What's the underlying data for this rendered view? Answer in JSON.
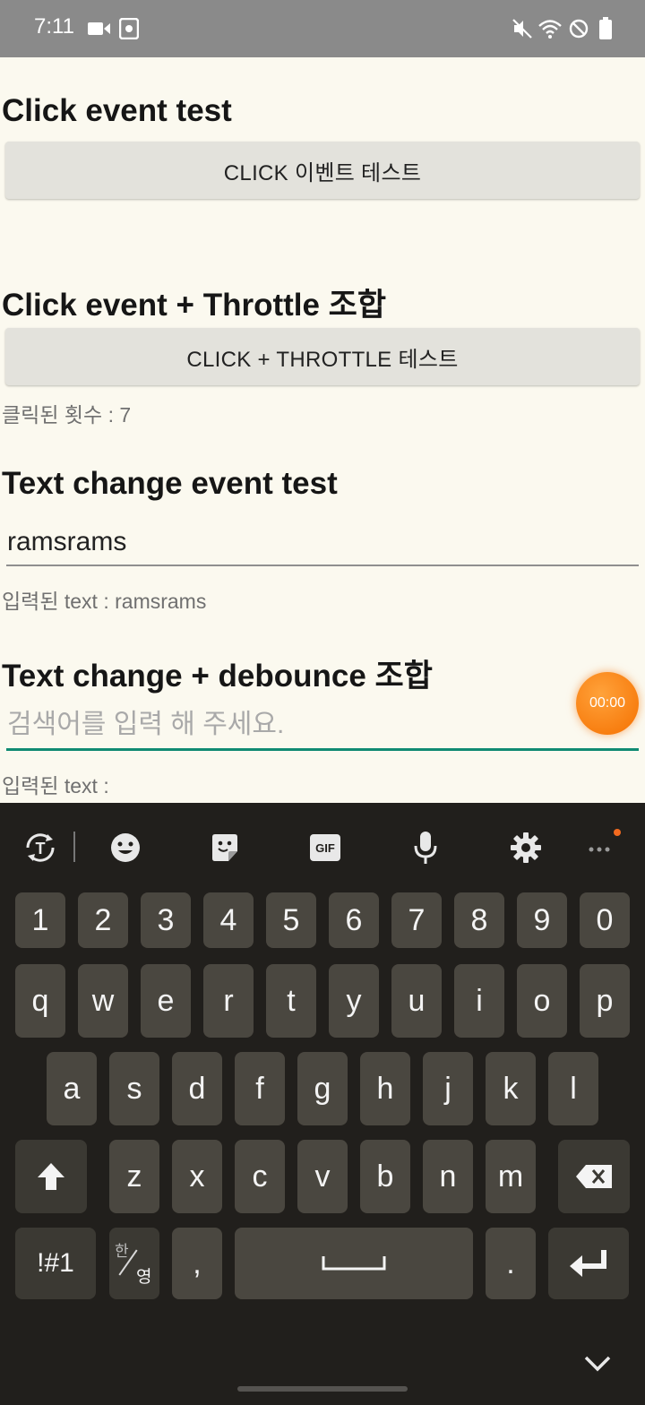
{
  "status_bar": {
    "time": "7:11"
  },
  "sections": {
    "click": {
      "title": "Click event test",
      "button": "CLICK 이벤트 테스트"
    },
    "throttle": {
      "title": "Click event + Throttle 조합",
      "button": "CLICK + THROTTLE 테스트",
      "count_text": "클릭된 횟수 : 7"
    },
    "text_change": {
      "title": "Text change event test",
      "input_value": "ramsrams",
      "result_text": "입력된 text : ramsrams"
    },
    "debounce": {
      "title": "Text change + debounce 조합",
      "input_placeholder": "검색어를 입력 해 주세요.",
      "result_text": "입력된 text :"
    }
  },
  "recorder": {
    "timer": "00:00"
  },
  "keyboard": {
    "toolbar_icons": [
      "translate-icon",
      "emoji-icon",
      "sticker-icon",
      "gif-icon",
      "mic-icon",
      "settings-icon",
      "more-icon"
    ],
    "gif_label": "GIF",
    "number_row": [
      "1",
      "2",
      "3",
      "4",
      "5",
      "6",
      "7",
      "8",
      "9",
      "0"
    ],
    "row1": [
      "q",
      "w",
      "e",
      "r",
      "t",
      "y",
      "u",
      "i",
      "o",
      "p"
    ],
    "row2": [
      "a",
      "s",
      "d",
      "f",
      "g",
      "h",
      "j",
      "k",
      "l"
    ],
    "row3": [
      "z",
      "x",
      "c",
      "v",
      "b",
      "n",
      "m"
    ],
    "symbols_label": "!#1",
    "lang_top": "한",
    "lang_bottom": "영",
    "comma": ",",
    "period": "."
  },
  "colors": {
    "accent": "#0f8a72",
    "timer": "#f57000",
    "background": "#fbf9ef",
    "keyboard": "#211f1c"
  }
}
